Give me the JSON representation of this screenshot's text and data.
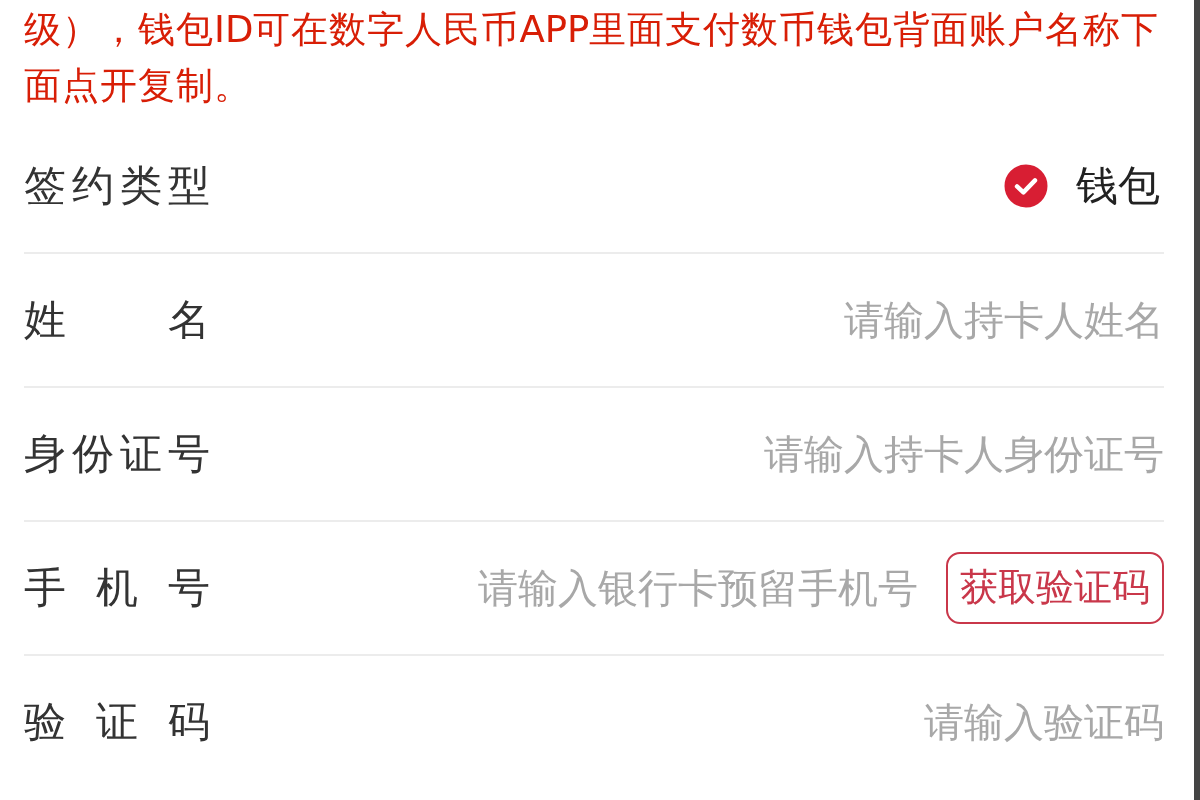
{
  "notice": "级），钱包ID可在数字人民币APP里面支付数币钱包背面账户名称下面点开复制。",
  "rows": [
    {
      "kind": "choice",
      "label": "签约类型",
      "option": {
        "label": "钱包",
        "checked": true
      }
    },
    {
      "kind": "input",
      "label": "姓 名",
      "placeholder": "请输入持卡人姓名"
    },
    {
      "kind": "input",
      "label": "身份证号",
      "placeholder": "请输入持卡人身份证号"
    },
    {
      "kind": "code",
      "label": "手 机 号",
      "placeholder": "请输入银行卡预留手机号",
      "button": "获取验证码"
    },
    {
      "kind": "input",
      "label": "验 证 码",
      "placeholder": "请输入验证码"
    }
  ]
}
